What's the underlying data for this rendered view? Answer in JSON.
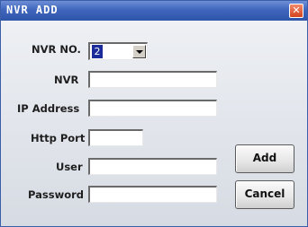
{
  "window": {
    "title": "NVR ADD",
    "close_icon": "close-icon"
  },
  "form": {
    "nvr_no_label": "NVR NO.",
    "nvr_no_value": "2",
    "nvr_label": "NVR",
    "nvr_value": "",
    "ip_label": "IP Address",
    "ip_value": "",
    "port_label": "Http Port",
    "port_value": "",
    "user_label": "User",
    "user_value": "",
    "password_label": "Password",
    "password_value": ""
  },
  "buttons": {
    "add": "Add",
    "cancel": "Cancel"
  },
  "colors": {
    "titlebar": "#3f66bd",
    "close": "#d4431f",
    "selected_highlight": "#1b2b9a"
  }
}
